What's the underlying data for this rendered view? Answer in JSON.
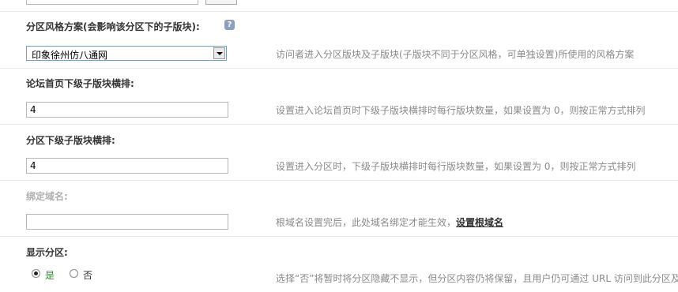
{
  "theme": {
    "label_color": "#333333",
    "help_color": "#8a8a8a",
    "disabled_color": "#b0b0b0",
    "yes_color": "#2a8a2a"
  },
  "sections": {
    "style": {
      "label": "分区风格方案(会影响该分区下的子版块):",
      "help_icon_glyph": "?",
      "selected": "印象徐州仿八通网",
      "help": "访问者进入分区版块及子版块(子版块不同于分区风格，可单独设置)所使用的风格方案"
    },
    "index_cols": {
      "label": "论坛首页下级子版块横排:",
      "value": "4",
      "help": "设置进入论坛首页时下级子版块横排时每行版块数量，如果设置为 0，则按正常方式排列"
    },
    "group_cols": {
      "label": "分区下级子版块横排:",
      "value": "4",
      "help": "设置进入分区时，下级子版块横排时每行版块数量，如果设置为 0，则按正常方式排列"
    },
    "domain": {
      "label": "绑定域名:",
      "value": "",
      "help": "根域名设置完后，此处域名绑定才能生效，",
      "link": "设置根域名"
    },
    "display": {
      "label": "显示分区:",
      "options": [
        "是",
        "否"
      ],
      "selected": "是",
      "help": "选择“否”将暂时将分区隐藏不显示，但分区内容仍将保留，且用户仍可通过 URL 访问到此分区及"
    }
  }
}
